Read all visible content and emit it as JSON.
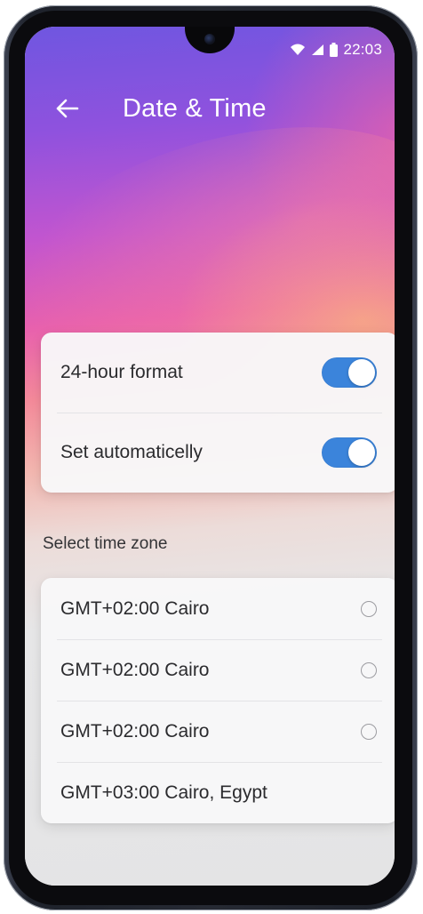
{
  "status_bar": {
    "time": "22:03"
  },
  "header": {
    "title": "Date & Time"
  },
  "settings": [
    {
      "label": "24-hour format",
      "enabled": true
    },
    {
      "label": "Set automaticelly",
      "enabled": true
    }
  ],
  "timezone": {
    "section_label": "Select time zone",
    "options": [
      {
        "label": "GMT+02:00 Cairo",
        "selected": false
      },
      {
        "label": "GMT+02:00 Cairo",
        "selected": false
      },
      {
        "label": "GMT+02:00 Cairo",
        "selected": false
      },
      {
        "label": "GMT+03:00 Cairo, Egypt",
        "selected": null
      }
    ]
  },
  "colors": {
    "accent": "#3b84db",
    "gradient_top": "#6f56e0",
    "gradient_mid": "#e861ad",
    "gradient_warm": "#f8b67e",
    "card_bg": "#f8f8f9"
  },
  "icons": {
    "back": "arrow-left-icon",
    "wifi": "wifi-icon",
    "signal": "cell-signal-icon",
    "battery": "battery-icon",
    "camera": "front-camera-icon"
  }
}
